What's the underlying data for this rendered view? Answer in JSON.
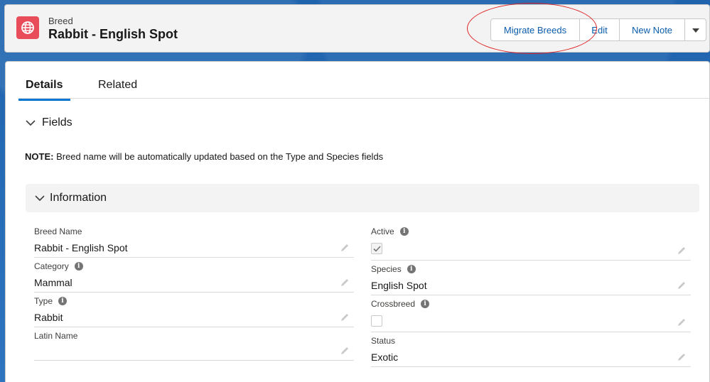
{
  "header": {
    "entity_type": "Breed",
    "record_title": "Rabbit - English Spot",
    "buttons": {
      "migrate": "Migrate Breeds",
      "edit": "Edit",
      "new_note": "New Note"
    }
  },
  "tabs": [
    {
      "label": "Details",
      "active": true
    },
    {
      "label": "Related",
      "active": false
    }
  ],
  "fields_section": {
    "title": "Fields",
    "note_prefix": "NOTE:",
    "note_text": " Breed name will be automatically updated based on the Type and Species fields"
  },
  "information": {
    "title": "Information",
    "left": [
      {
        "label": "Breed Name",
        "value": "Rabbit - English Spot",
        "info": false
      },
      {
        "label": "Category",
        "value": "Mammal",
        "info": true
      },
      {
        "label": "Type",
        "value": "Rabbit",
        "info": true
      },
      {
        "label": "Latin Name",
        "value": "",
        "info": false
      }
    ],
    "right": [
      {
        "label": "Active",
        "checked": true,
        "info": true
      },
      {
        "label": "Species",
        "value": "English Spot",
        "info": true
      },
      {
        "label": "Crossbreed",
        "checked": false,
        "info": true
      },
      {
        "label": "Status",
        "value": "Exotic",
        "info": false
      }
    ]
  },
  "colors": {
    "brand_blue": "#0176d3",
    "link_blue": "#0b5cab",
    "entity_icon": "#e94d59",
    "annotation_red": "#e02020"
  }
}
